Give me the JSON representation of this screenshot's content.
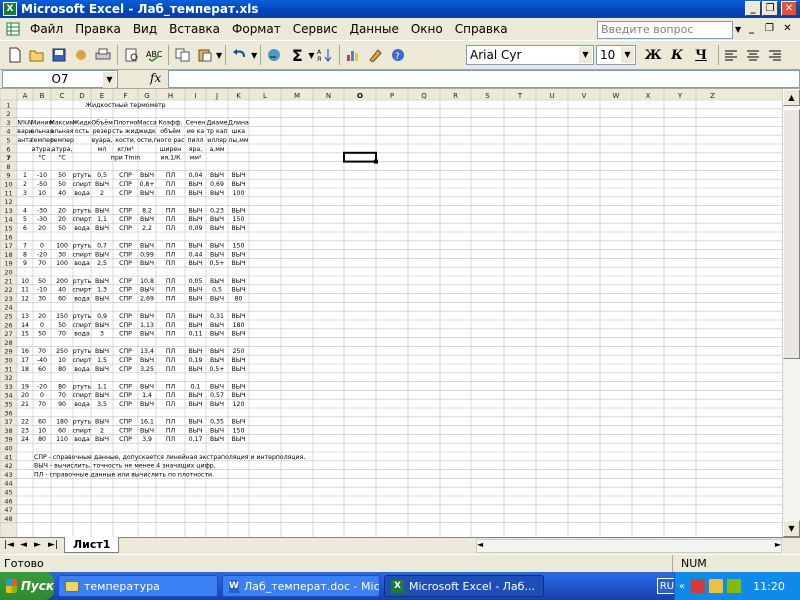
{
  "window": {
    "title": "Microsoft Excel - Лаб_температ.xls",
    "icon": "excel-icon"
  },
  "menu": {
    "items": [
      "Файл",
      "Правка",
      "Вид",
      "Вставка",
      "Формат",
      "Сервис",
      "Данные",
      "Окно",
      "Справка"
    ],
    "help_placeholder": "Введите вопрос"
  },
  "toolbar": {
    "font": "Arial Cyr",
    "size": "10",
    "bold": "Ж",
    "italic": "К",
    "underline": "Ч",
    "sum": "Σ"
  },
  "formula": {
    "cell_ref": "O7",
    "fx": "fx",
    "content": ""
  },
  "sheet": {
    "columns": [
      "A",
      "B",
      "C",
      "D",
      "E",
      "F",
      "G",
      "H",
      "I",
      "J",
      "K",
      "L",
      "M",
      "N",
      "O",
      "P",
      "Q",
      "R",
      "S",
      "T",
      "U",
      "V",
      "W",
      "X",
      "Y",
      "Z"
    ],
    "selected_cell": "O7",
    "title": "Жидкостный термометр",
    "headers": {
      "A": [
        "N%N",
        "вари",
        "анта"
      ],
      "B": [
        "Миним",
        "альная",
        "темпер",
        "атура,",
        "°C"
      ],
      "C": [
        "Максим",
        "альная",
        "темпер",
        "атура,",
        "°C"
      ],
      "D": [
        "Жидк",
        "ость"
      ],
      "E": [
        "Объём",
        "резер",
        "вуара,",
        "мл"
      ],
      "F": [
        "Плотно",
        "сть жид",
        "кости,",
        "кг/м³",
        "при Tmin"
      ],
      "G": [
        "Масса",
        "жидк",
        "ости,г"
      ],
      "H": [
        "Коэфф.",
        "объём",
        "ного рас",
        "ширен",
        "ия,1/К"
      ],
      "I": [
        "Сечен",
        "ие ка",
        "пилл",
        "яра,",
        "мм²"
      ],
      "J": [
        "Диаме",
        "тр кап",
        "илляр",
        "а,мм"
      ],
      "K": [
        "Длина",
        "шка",
        "лы,мм"
      ]
    },
    "data_rows": [
      {
        "row": 9,
        "cells": [
          "1",
          "-10",
          "50",
          "ртуть",
          "0,5",
          "СПР",
          "ВЫЧ",
          "ПЛ",
          "0,04",
          "ВЫЧ",
          "ВЫЧ"
        ]
      },
      {
        "row": 10,
        "cells": [
          "2",
          "-50",
          "50",
          "спирт",
          "ВЫЧ",
          "СПР",
          "0,8+",
          "ПЛ",
          "ВЫЧ",
          "0,69",
          "ВЫЧ"
        ]
      },
      {
        "row": 11,
        "cells": [
          "3",
          "10",
          "40",
          "вода",
          "2",
          "СПР",
          "ВЫЧ",
          "ПЛ",
          "ВЫЧ",
          "ВЫЧ",
          "100"
        ]
      },
      {
        "row": 13,
        "cells": [
          "4",
          "-30",
          "20",
          "ртуть",
          "ВЫЧ",
          "СПР",
          "8,2",
          "ПЛ",
          "ВЫЧ",
          "0,23",
          "ВЫЧ"
        ]
      },
      {
        "row": 14,
        "cells": [
          "5",
          "-30",
          "20",
          "спирт",
          "1,1",
          "СПР",
          "ВЫЧ",
          "ПЛ",
          "ВЫЧ",
          "ВЫЧ",
          "150"
        ]
      },
      {
        "row": 15,
        "cells": [
          "6",
          "20",
          "50",
          "вода",
          "ВЫЧ",
          "СПР",
          "2,2",
          "ПЛ",
          "0,09",
          "ВЫЧ",
          "ВЫЧ"
        ]
      },
      {
        "row": 17,
        "cells": [
          "7",
          "0",
          "100",
          "ртуть",
          "0,7",
          "СПР",
          "ВЫЧ",
          "ПЛ",
          "ВЫЧ",
          "ВЫЧ",
          "150"
        ]
      },
      {
        "row": 18,
        "cells": [
          "8",
          "-20",
          "30",
          "спирт",
          "ВЫЧ",
          "СПР",
          "0,99",
          "ПЛ",
          "0,44",
          "ВЫЧ",
          "ВЫЧ"
        ]
      },
      {
        "row": 19,
        "cells": [
          "9",
          "70",
          "100",
          "вода",
          "2,5",
          "СПР",
          "ВЫЧ",
          "ПЛ",
          "ВЫЧ",
          "0,5+",
          "ВЫЧ"
        ]
      },
      {
        "row": 21,
        "cells": [
          "10",
          "50",
          "200",
          "ртуть",
          "ВЫЧ",
          "СПР",
          "10,8",
          "ПЛ",
          "0,05",
          "ВЫЧ",
          "ВЫЧ"
        ]
      },
      {
        "row": 22,
        "cells": [
          "11",
          "-10",
          "40",
          "спирт",
          "1,3",
          "СПР",
          "ВЫЧ",
          "ПЛ",
          "ВЫЧ",
          "0,5",
          "ВЫЧ"
        ]
      },
      {
        "row": 23,
        "cells": [
          "12",
          "30",
          "60",
          "вода",
          "ВЫЧ",
          "СПР",
          "2,69",
          "ПЛ",
          "ВЫЧ",
          "ВЫЧ",
          "80"
        ]
      },
      {
        "row": 25,
        "cells": [
          "13",
          "20",
          "150",
          "ртуть",
          "0,9",
          "СПР",
          "ВЫЧ",
          "ПЛ",
          "ВЫЧ",
          "0,31",
          "ВЫЧ"
        ]
      },
      {
        "row": 26,
        "cells": [
          "14",
          "0",
          "50",
          "спирт",
          "ВЫЧ",
          "СПР",
          "1,13",
          "ПЛ",
          "ВЫЧ",
          "ВЫЧ",
          "180"
        ]
      },
      {
        "row": 27,
        "cells": [
          "15",
          "50",
          "70",
          "вода",
          "3",
          "СПР",
          "ВЫЧ",
          "ПЛ",
          "0,11",
          "ВЫЧ",
          "ВЫЧ"
        ]
      },
      {
        "row": 29,
        "cells": [
          "16",
          "70",
          "250",
          "ртуть",
          "ВЫЧ",
          "СПР",
          "13,4",
          "ПЛ",
          "ВЫЧ",
          "ВЫЧ",
          "250"
        ]
      },
      {
        "row": 30,
        "cells": [
          "17",
          "-40",
          "10",
          "спирт",
          "1,5",
          "СПР",
          "ВЫЧ",
          "ПЛ",
          "0,19",
          "ВЫЧ",
          "ВЫЧ"
        ]
      },
      {
        "row": 31,
        "cells": [
          "18",
          "60",
          "80",
          "вода",
          "ВЫЧ",
          "СПР",
          "3,25",
          "ПЛ",
          "ВЫЧ",
          "0,5+",
          "ВЫЧ"
        ]
      },
      {
        "row": 33,
        "cells": [
          "19",
          "-20",
          "80",
          "ртуть",
          "1,1",
          "СПР",
          "ВЫЧ",
          "ПЛ",
          "0,1",
          "ВЫЧ",
          "ВЫЧ"
        ]
      },
      {
        "row": 34,
        "cells": [
          "20",
          "0",
          "70",
          "спирт",
          "ВЫЧ",
          "СПР",
          "1,4",
          "ПЛ",
          "ВЫЧ",
          "0,57",
          "ВЫЧ"
        ]
      },
      {
        "row": 35,
        "cells": [
          "21",
          "70",
          "90",
          "вода",
          "3,5",
          "СПР",
          "ВЫЧ",
          "ПЛ",
          "ВЫЧ",
          "ВЫЧ",
          "120"
        ]
      },
      {
        "row": 37,
        "cells": [
          "22",
          "60",
          "180",
          "ртуть",
          "ВЫЧ",
          "СПР",
          "16,1",
          "ПЛ",
          "ВЫЧ",
          "0,35",
          "ВЫЧ"
        ]
      },
      {
        "row": 38,
        "cells": [
          "23",
          "10",
          "60",
          "спирт",
          "2",
          "СПР",
          "ВЫЧ",
          "ПЛ",
          "ВЫЧ",
          "ВЫЧ",
          "150"
        ]
      },
      {
        "row": 39,
        "cells": [
          "24",
          "80",
          "110",
          "вода",
          "ВЫЧ",
          "СПР",
          "3,9",
          "ПЛ",
          "0,17",
          "ВЫЧ",
          "ВЫЧ"
        ]
      }
    ],
    "notes": [
      {
        "row": 41,
        "text": "СПР - справочные данные, допускается линейная экстраполяция и интерполяция."
      },
      {
        "row": 42,
        "text": "ВЫЧ - вычислить, точность не менее 4 значащих цифр."
      },
      {
        "row": 43,
        "text": "ПЛ - справочные данные или вычислить по плотности."
      }
    ],
    "tab": "Лист1"
  },
  "status": {
    "left": "Готово",
    "num": "NUM"
  },
  "taskbar": {
    "start": "Пуск",
    "tasks": [
      "температура",
      "Лаб_температ.doc - Mic...",
      "Microsoft Excel - Лаб..."
    ],
    "lang": "RU",
    "time": "11:20"
  }
}
